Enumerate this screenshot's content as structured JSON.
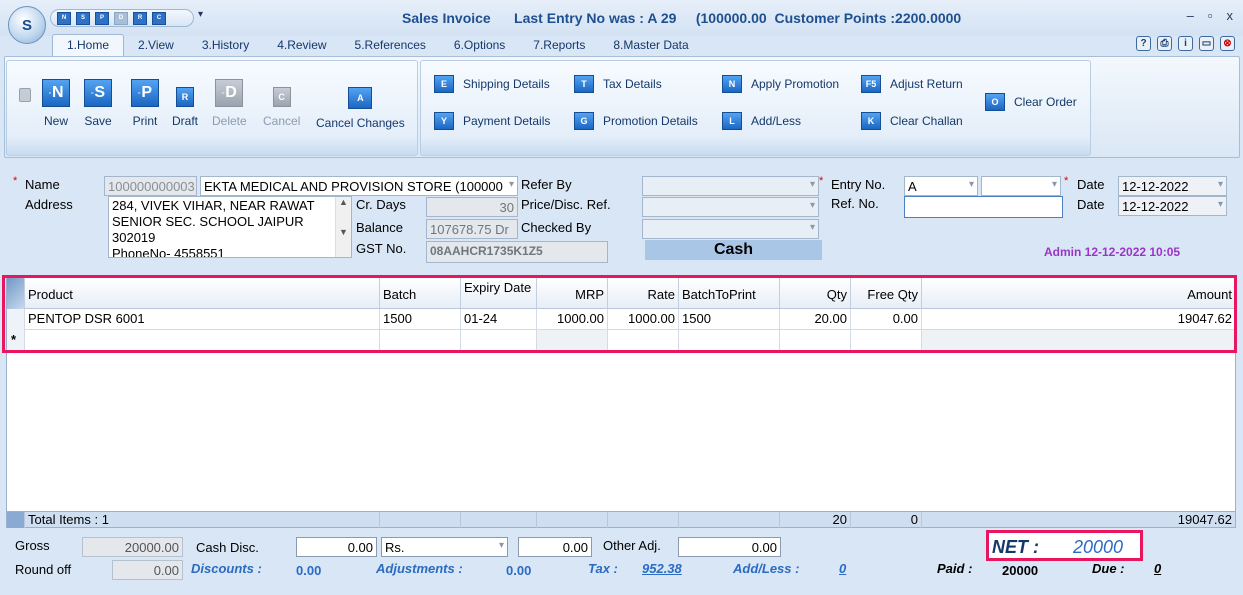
{
  "titlebar": {
    "logo": "S",
    "title": "Sales Invoice      Last Entry No was : A 29     (100000.00  Customer Points :2200.0000",
    "qat_icons": [
      "N",
      "S",
      "P",
      "D",
      "R",
      "C"
    ],
    "min": "–",
    "max": "▫",
    "close": "x"
  },
  "tabs": [
    "1.Home",
    "2.View",
    "3.History",
    "4.Review",
    "5.References",
    "6.Options",
    "7.Reports",
    "8.Master Data"
  ],
  "tab_icons": [
    "help-icon",
    "print-icon",
    "info-icon",
    "window-icon",
    "close-icon"
  ],
  "ribbon": {
    "big_buttons": [
      {
        "label": "New",
        "icon": "N",
        "enabled": true
      },
      {
        "label": "Save",
        "icon": "S",
        "enabled": true
      },
      {
        "label": "Print",
        "icon": "P",
        "enabled": true
      },
      {
        "label": "Draft",
        "icon": "R",
        "enabled": true
      },
      {
        "label": "Delete",
        "icon": "D",
        "enabled": false
      },
      {
        "label": "Cancel",
        "icon": "C",
        "enabled": false
      },
      {
        "label": "Cancel Changes",
        "icon": "A",
        "enabled": true
      }
    ],
    "small_buttons": [
      {
        "label": "Shipping Details",
        "icon": "E"
      },
      {
        "label": "Payment Details",
        "icon": "Y"
      },
      {
        "label": "Tax Details",
        "icon": "T"
      },
      {
        "label": "Promotion Details",
        "icon": "G"
      },
      {
        "label": "Apply Promotion",
        "icon": "N"
      },
      {
        "label": "Add/Less",
        "icon": "L"
      },
      {
        "label": "Adjust Return",
        "icon": "F5"
      },
      {
        "label": "Clear Challan",
        "icon": "K"
      },
      {
        "label": "Clear Order",
        "icon": "O"
      }
    ]
  },
  "form": {
    "name_label": "Name",
    "name_code": "100000000003",
    "name_value": "EKTA MEDICAL AND PROVISION STORE (100000",
    "address_label": "Address",
    "address_lines": [
      "284, VIVEK VIHAR, NEAR RAWAT",
      "SENIOR  SEC. SCHOOL JAIPUR",
      "302019",
      "PhoneNo- 4558551"
    ],
    "cr_days_label": "Cr. Days",
    "cr_days": "30",
    "balance_label": "Balance",
    "balance": "107678.75 Dr",
    "gst_label": "GST No.",
    "gst": "08AAHCR1735K1Z5",
    "refer_by_label": "Refer By",
    "price_disc_label": "Price/Disc. Ref.",
    "checked_by_label": "Checked By",
    "cash_label": "Cash",
    "entry_no_label": "Entry No.",
    "entry_no_series": "A",
    "ref_no_label": "Ref. No.",
    "date_label": "Date",
    "date1": "12-12-2022",
    "date2_label": "Date",
    "date2": "12-12-2022",
    "admin_line": "Admin 12-12-2022 10:05"
  },
  "grid": {
    "columns": [
      "Product",
      "Batch",
      "Expiry Date",
      "MRP",
      "Rate",
      "BatchToPrint",
      "Qty",
      "Free Qty",
      "Amount"
    ],
    "rows": [
      {
        "product": "PENTOP DSR 6001",
        "batch": "1500",
        "expiry": "01-24",
        "mrp": "1000.00",
        "rate": "1000.00",
        "batch_to_print": "1500",
        "qty": "20.00",
        "free_qty": "0.00",
        "amount": "19047.62"
      }
    ],
    "new_row_marker": "*",
    "footer": {
      "total_items": "Total Items : 1",
      "qty": "20",
      "free_qty": "0",
      "amount": "19047.62"
    }
  },
  "bottom": {
    "gross_label": "Gross",
    "gross": "20000.00",
    "round_off_label": "Round off",
    "round_off": "0.00",
    "cash_disc_label": "Cash Disc.",
    "cash_disc": "0.00",
    "cash_disc_unit": "Rs.",
    "cash_disc_amount": "0.00",
    "other_adj_label": "Other Adj.",
    "other_adj": "0.00",
    "discounts_label": "Discounts :",
    "discounts": "0.00",
    "adjustments_label": "Adjustments :",
    "adjustments": "0.00",
    "tax_label": "Tax :",
    "tax": "952.38",
    "addless_label": "Add/Less :",
    "addless": "0",
    "paid_label": "Paid :",
    "paid": "20000",
    "due_label": "Due :",
    "due": "0",
    "net_label": "NET :",
    "net": "20000"
  }
}
